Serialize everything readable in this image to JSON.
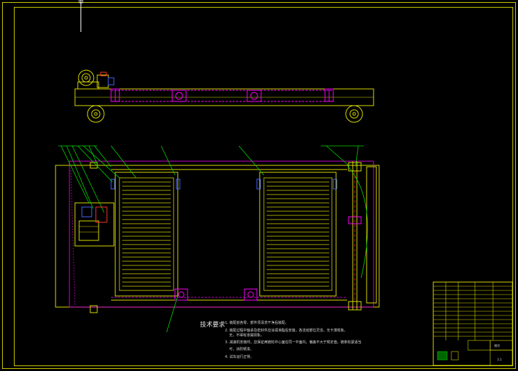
{
  "drawing": {
    "colors": {
      "background": "#000000",
      "border": "#cccc00",
      "structure": "#dddd00",
      "hidden_line": "#ff00ff",
      "leader": "#00dd00",
      "annotation": "#e0e0e0",
      "accent_blue": "#4466ff",
      "accent_red": "#ff3333"
    },
    "tech_requirements": {
      "title": "技术要求",
      "items": [
        "1. 装配前各零、部件须清洗干净后装配。",
        "2. 装配过程中轴承及密封件应涂润滑脂后安装，各活动部位灵活，无卡滞现象。",
        "   无，不得有渗漏现象。",
        "3. 减速机安装时，应保证两链轮中心面在同一平面内，偏差不大于规定值，链条松紧适当",
        "   可，涂防锈漆。",
        "4. 试车运行正常。"
      ]
    },
    "title_block": {
      "scale": "1:1",
      "label_small": "图号"
    }
  }
}
